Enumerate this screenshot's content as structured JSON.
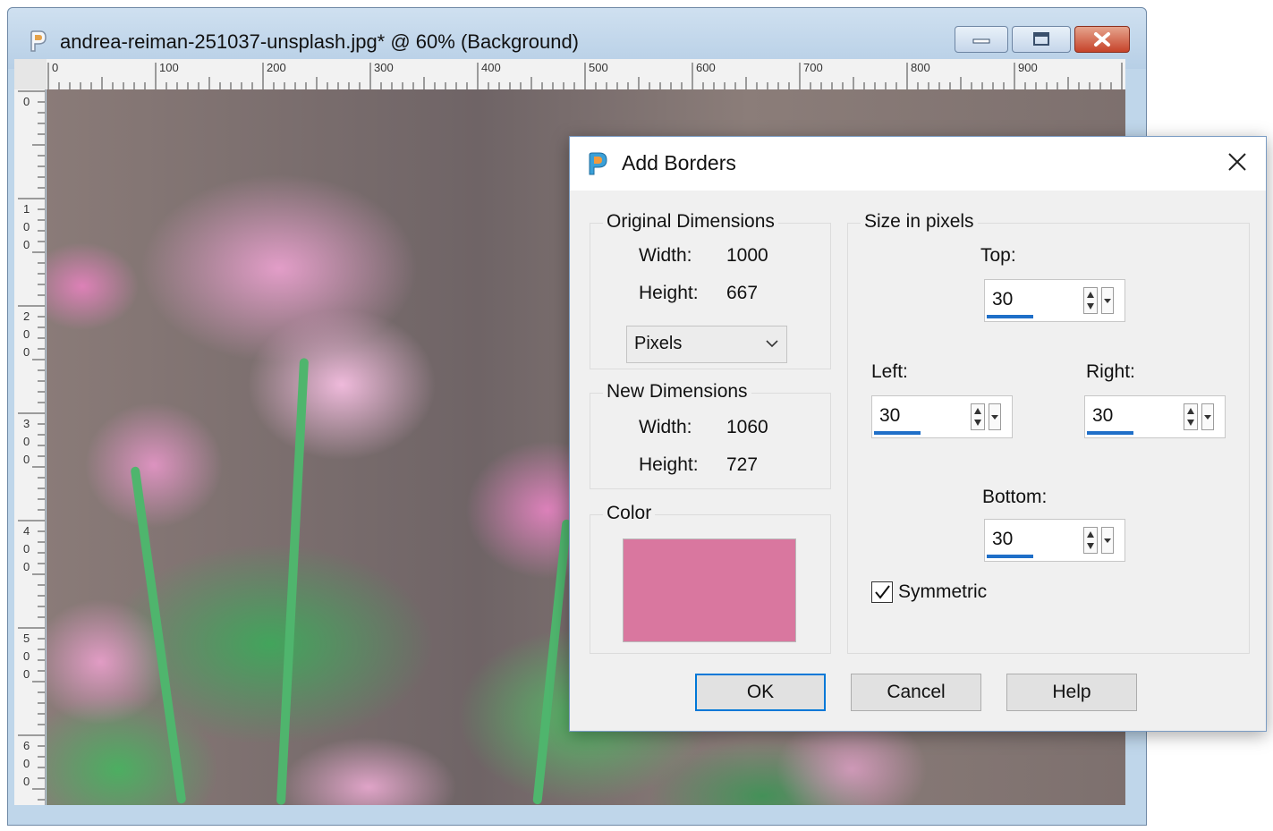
{
  "window": {
    "title": "andrea-reiman-251037-unsplash.jpg* @  60% (Background)",
    "icon": "paintshop-pro-icon"
  },
  "rulers": {
    "top_labels": [
      "0",
      "100",
      "200",
      "300",
      "400",
      "500",
      "600",
      "700",
      "800",
      "900"
    ],
    "left_labels": [
      "0",
      "1\n0\n0",
      "2\n0\n0",
      "3\n0\n0",
      "4\n0\n0",
      "5\n0\n0",
      "6\n0\n0"
    ]
  },
  "dialog": {
    "title": "Add Borders",
    "original": {
      "group_label": "Original Dimensions",
      "width_label": "Width:",
      "width_value": "1000",
      "height_label": "Height:",
      "height_value": "667",
      "units_value": "Pixels"
    },
    "new": {
      "group_label": "New Dimensions",
      "width_label": "Width:",
      "width_value": "1060",
      "height_label": "Height:",
      "height_value": "727"
    },
    "color": {
      "group_label": "Color",
      "swatch_color": "#d9779f"
    },
    "size": {
      "group_label": "Size in pixels",
      "top_label": "Top:",
      "top_value": "30",
      "left_label": "Left:",
      "left_value": "30",
      "right_label": "Right:",
      "right_value": "30",
      "bottom_label": "Bottom:",
      "bottom_value": "30",
      "symmetric_label": "Symmetric",
      "symmetric_checked": true
    },
    "buttons": {
      "ok": "OK",
      "cancel": "Cancel",
      "help": "Help"
    }
  }
}
